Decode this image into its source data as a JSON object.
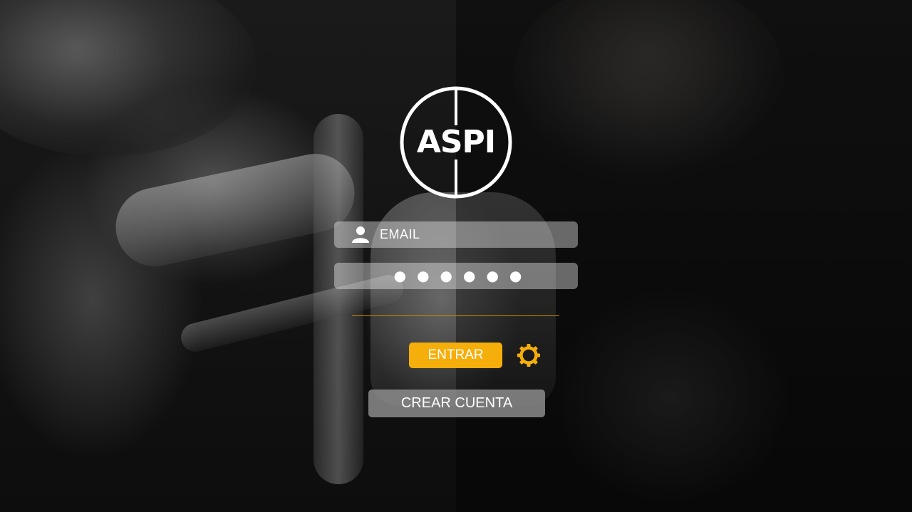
{
  "brand": {
    "logo_text": "ASPI",
    "accent_color": "#f6ae0a"
  },
  "login_form": {
    "email_placeholder": "EMAIL",
    "password_mask": "●●●●●●",
    "user_icon": "user-icon",
    "enter_label": "ENTRAR",
    "settings_icon": "gear-icon",
    "create_account_label": "CREAR CUENTA"
  }
}
